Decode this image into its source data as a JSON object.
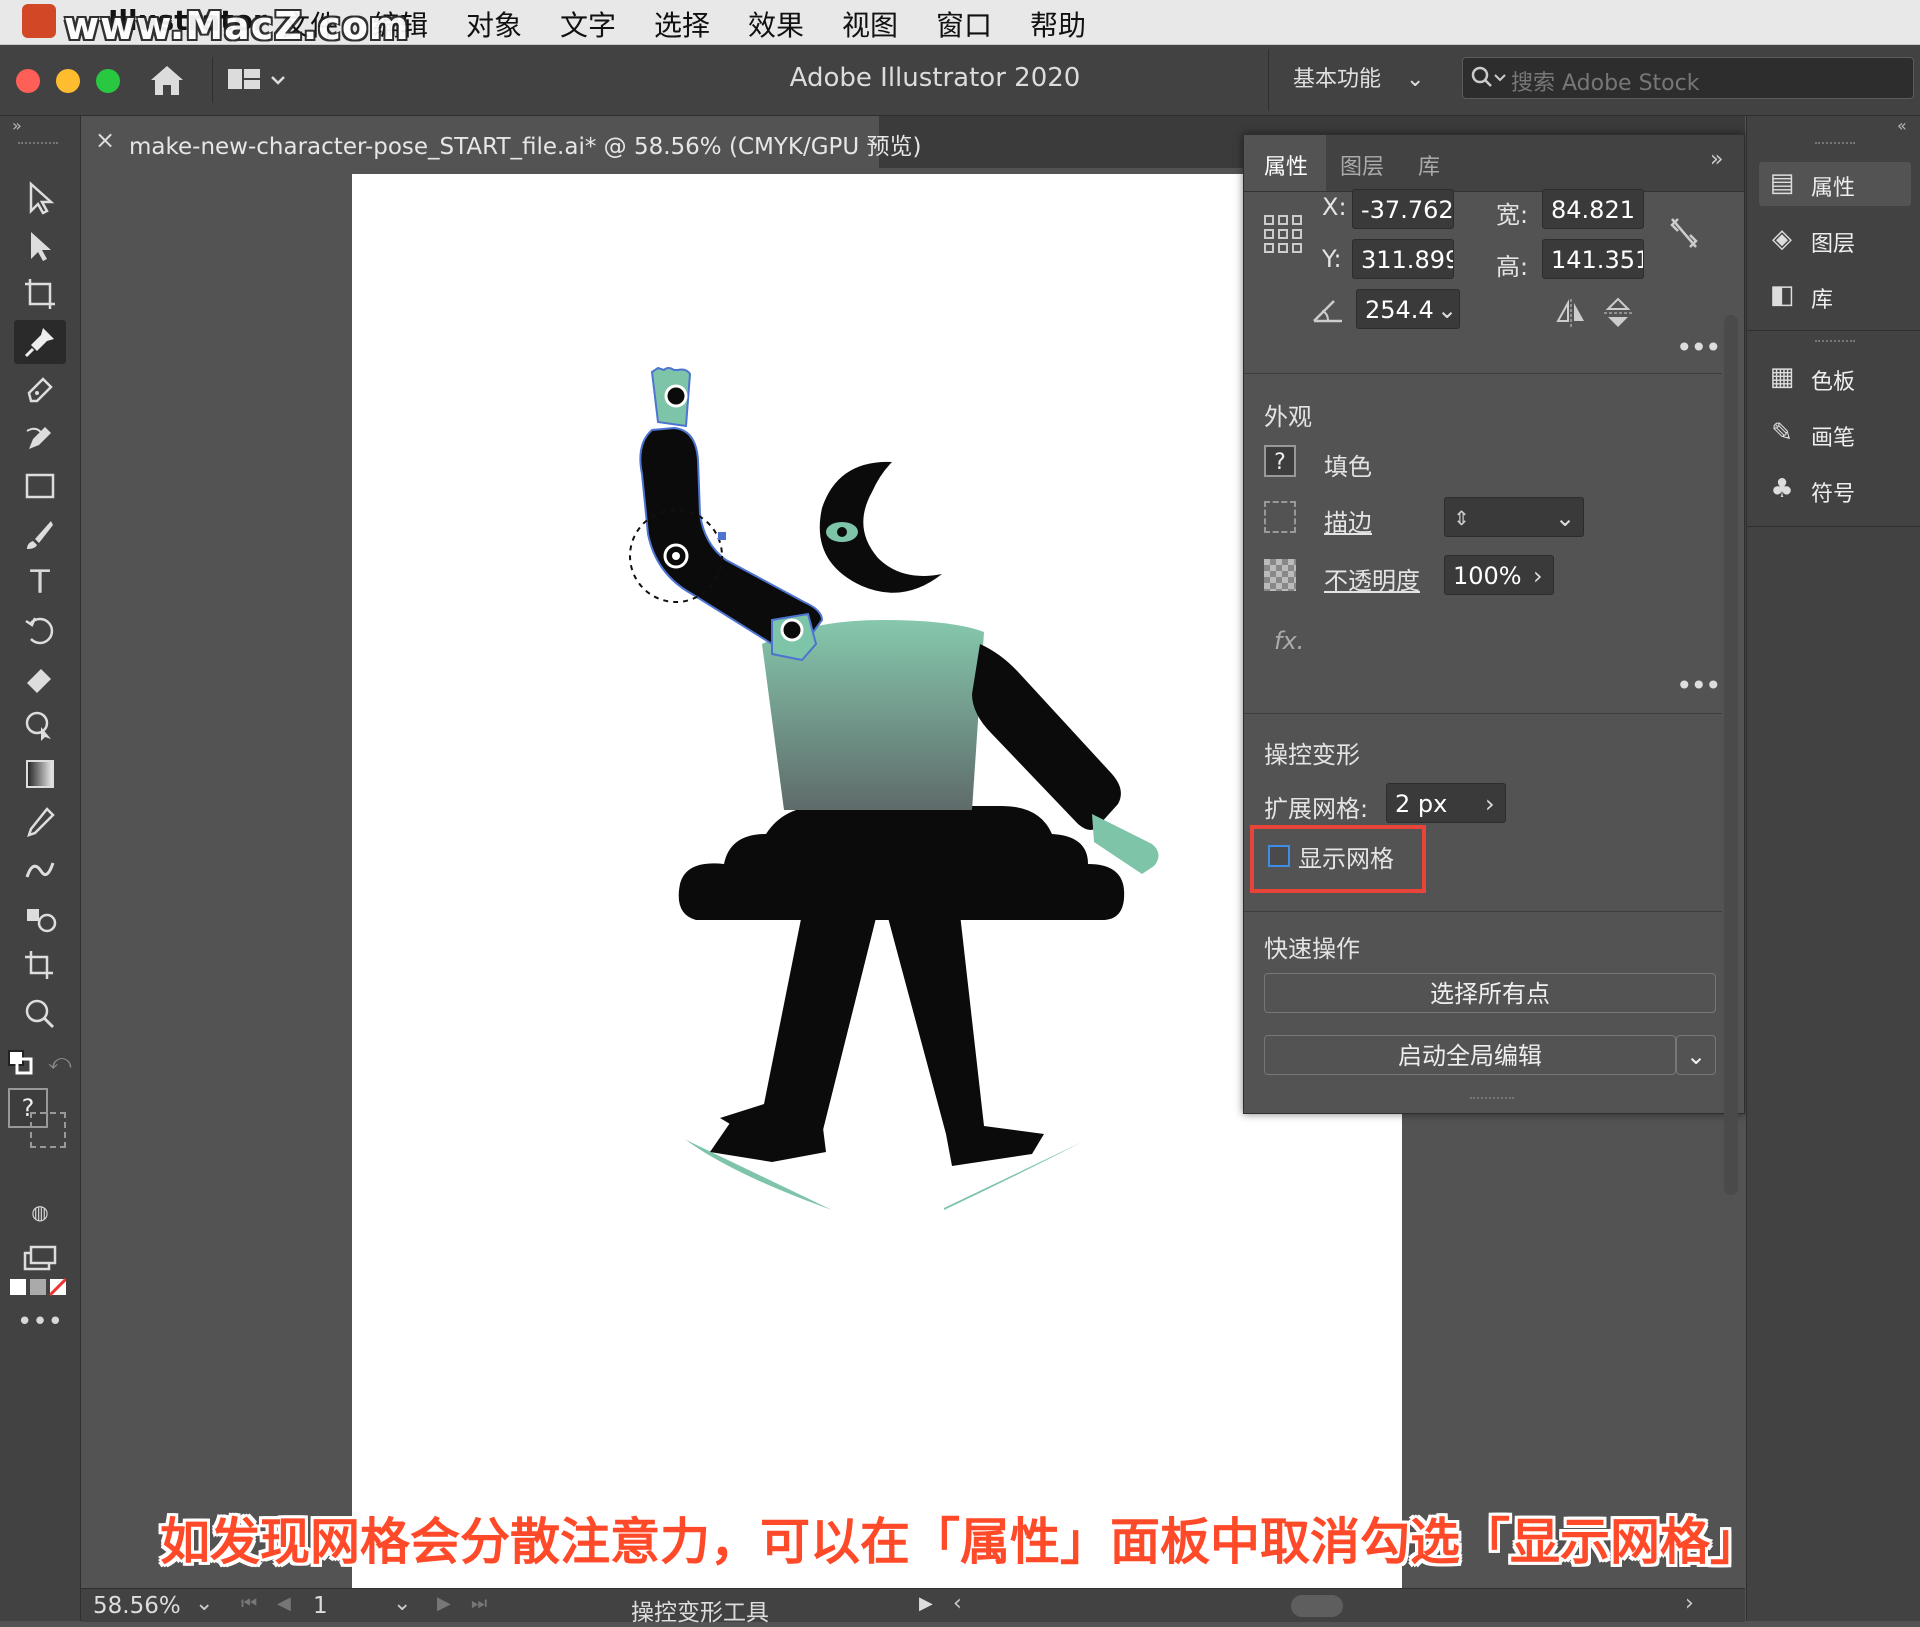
{
  "watermark": "www.MacZ.com",
  "menubar": {
    "app_name": "Illustrator",
    "items": [
      "文件",
      "编辑",
      "对象",
      "文字",
      "选择",
      "效果",
      "视图",
      "窗口",
      "帮助"
    ]
  },
  "appbar": {
    "title": "Adobe Illustrator 2020",
    "workspace": "基本功能",
    "search_placeholder": "搜索 Adobe Stock"
  },
  "document_tab": {
    "close_label": "×",
    "title": "make-new-character-pose_START_file.ai* @ 58.56% (CMYK/GPU 预览)"
  },
  "properties_panel": {
    "tabs": [
      "属性",
      "图层",
      "库"
    ],
    "active_tab": "属性",
    "transform": {
      "x_label": "X:",
      "x_value": "-37.762(",
      "y_label": "Y:",
      "y_value": "311.899",
      "w_label": "宽:",
      "w_value": "84.821 p",
      "h_label": "高:",
      "h_value": "141.351",
      "angle_value": "254.4"
    },
    "appearance": {
      "section": "外观",
      "fill_label": "填色",
      "stroke_label": "描边",
      "opacity_label": "不透明度",
      "opacity_value": "100%",
      "fx_label": "fx."
    },
    "puppet_warp": {
      "section": "操控变形",
      "expand_mesh_label": "扩展网格:",
      "expand_mesh_value": "2 px",
      "show_mesh_label": "显示网格",
      "show_mesh_checked": false
    },
    "quick_actions": {
      "section": "快速操作",
      "select_all_points": "选择所有点",
      "global_edit": "启动全局编辑"
    }
  },
  "dock": {
    "items": [
      "属性",
      "图层",
      "库",
      "色板",
      "画笔",
      "符号"
    ]
  },
  "statusbar": {
    "zoom": "58.56%",
    "page": "1",
    "tool": "操控变形工具"
  },
  "caption": "如发现网格会分散注意力，可以在「属性」面板中取消勾选「显示网格」",
  "colors": {
    "accent_highlight": "#e8443a",
    "mint": "#7dc4a8",
    "figure": "#0b0b0c"
  }
}
